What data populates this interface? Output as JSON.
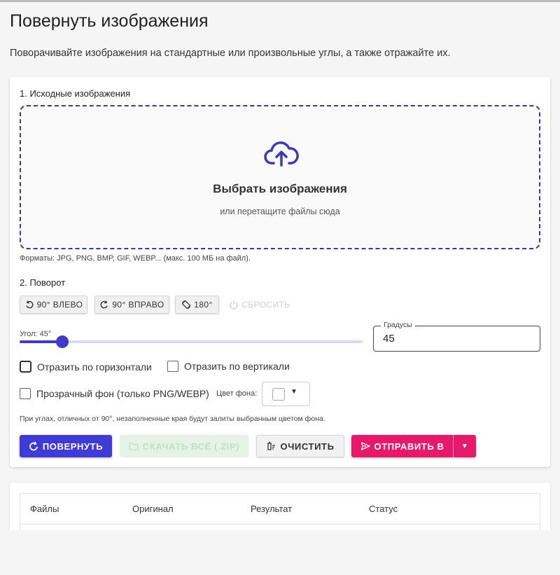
{
  "page": {
    "title": "Повернуть изображения",
    "description": "Поворачивайте изображения на стандартные или произвольные углы, а также отражайте их."
  },
  "source": {
    "section_label": "1. Исходные изображения",
    "dropzone_title": "Выбрать изображения",
    "dropzone_subtitle": "или перетащите файлы сюда",
    "formats_note": "Форматы: JPG, PNG, BMP, GIF, WEBP... (макс. 100 МБ на файл).",
    "icon": "cloud-upload-icon"
  },
  "rotation": {
    "section_label": "2. Поворот",
    "buttons": {
      "left": "90° ВЛЕВО",
      "right": "90° ВПРАВО",
      "flip180": "180°",
      "reset": "СБРОСИТЬ"
    },
    "angle_label": "Угол: 45°",
    "angle_value": 45,
    "angle_slider_fraction": 0.125,
    "degrees_label": "Градусы",
    "degrees_value": "45",
    "flip_horizontal": "Отразить по горизонтали",
    "flip_vertical": "Отразить по вертикали",
    "transparent_bg": "Прозрачный фон (только PNG/WEBP)",
    "bg_color_label": "Цвет фона:",
    "bg_color": "#ffffff",
    "note": "При углах, отличных от 90°, незаполненные края будут залиты выбранным цветом фона."
  },
  "actions": {
    "rotate": "ПОВЕРНУТЬ",
    "download_all": "СКАЧАТЬ ВСЁ (.ZIP)",
    "clear": "ОЧИСТИТЬ",
    "send_to": "ОТПРАВИТЬ В"
  },
  "table": {
    "columns": [
      "Файлы",
      "Оригинал",
      "Результат",
      "Статус"
    ]
  },
  "colors": {
    "primary": "#3f3cd6",
    "accent": "#e6196a",
    "success_disabled": "#e5f3e6",
    "dropzone_border": "#3d3a8c"
  }
}
